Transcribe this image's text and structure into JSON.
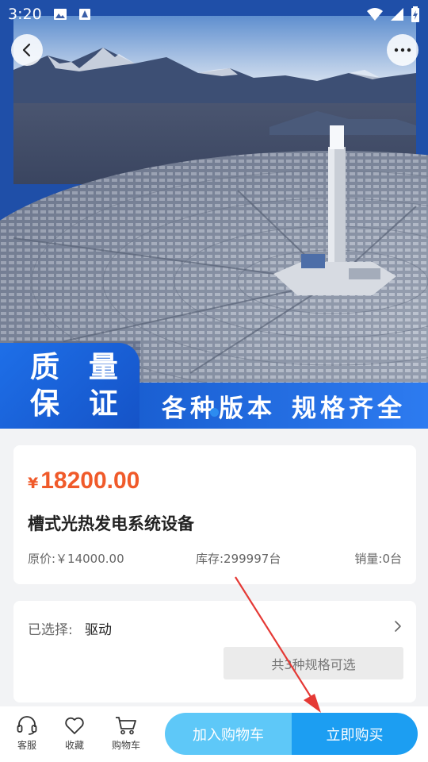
{
  "status_bar": {
    "time": "3:20"
  },
  "hero": {
    "badge_lines": [
      "质 量",
      "保 证"
    ],
    "slogan_left": "各种版本",
    "slogan_right": "规格齐全"
  },
  "product": {
    "currency": "¥",
    "price": "18200.00",
    "name": "槽式光热发电系统设备",
    "original_price": "原价:￥14000.00",
    "stock": "库存:299997台",
    "sales": "销量:0台"
  },
  "spec": {
    "selected_label": "已选择:",
    "selected_value": "驱动",
    "spec_count": "共3种规格可选"
  },
  "bottom_bar": {
    "service_label": "客服",
    "favorite_label": "收藏",
    "cart_label": "购物车",
    "add_to_cart": "加入购物车",
    "buy_now": "立即购买"
  },
  "icons": [
    "back-icon",
    "more-icon",
    "headset-icon",
    "heart-icon",
    "cart-icon",
    "chevron-right-icon"
  ],
  "colors": {
    "price": "#f05a2a",
    "buy_button": "#1c9ef2",
    "cart_button": "#5ec8f8",
    "banner_blue": "#1a5fd2",
    "annotation_arrow": "#e53935"
  }
}
